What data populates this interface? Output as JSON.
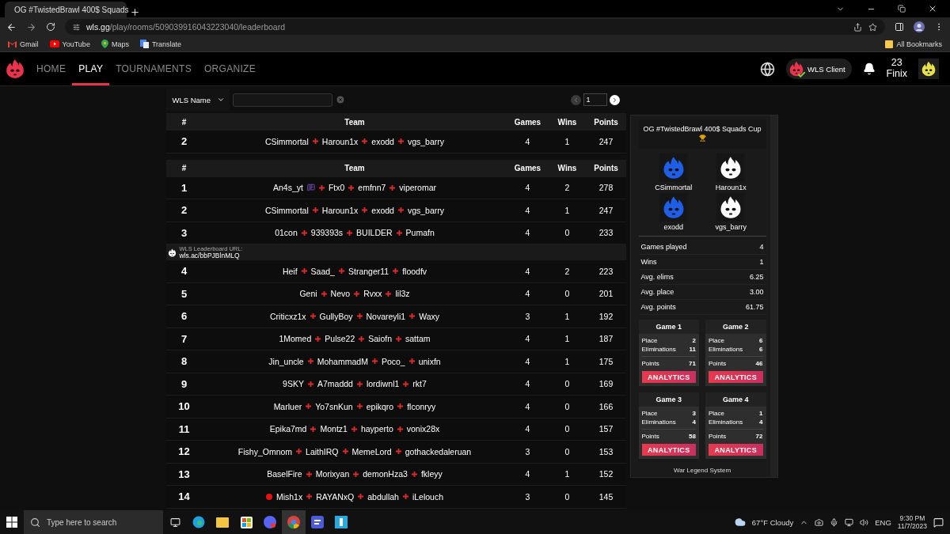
{
  "browser": {
    "tab_title": "OG #TwistedBrawl 400$ Squads",
    "url_host": "wls.gg",
    "url_path": "/play/rooms/509039916043223040/leaderboard",
    "bookmarks": [
      {
        "kind": "gmail",
        "label": "Gmail"
      },
      {
        "kind": "youtube",
        "label": "YouTube"
      },
      {
        "kind": "maps",
        "label": "Maps"
      },
      {
        "kind": "translate",
        "label": "Translate"
      }
    ],
    "all_bookmarks": "All Bookmarks"
  },
  "nav": {
    "items": [
      {
        "label": "HOME",
        "selected": false
      },
      {
        "label": "PLAY",
        "selected": true
      },
      {
        "label": "TOURNAMENTS",
        "selected": false
      },
      {
        "label": "ORGANIZE",
        "selected": false
      }
    ],
    "client_button": "WLS Client",
    "user_level": "23",
    "user_name": "Finix"
  },
  "filter": {
    "select": "WLS Name",
    "page_value": "1"
  },
  "highlight_table": {
    "columns": [
      "#",
      "Team",
      "Games",
      "Wins",
      "Points"
    ],
    "rows": [
      {
        "rank": "2",
        "members": [
          {
            "name": "CSimmortal"
          },
          {
            "name": "Haroun1x"
          },
          {
            "name": "exodd"
          },
          {
            "name": "vgs_barry"
          }
        ],
        "games": "4",
        "wins": "1",
        "points": "247"
      }
    ]
  },
  "leaderboard": {
    "columns": [
      "#",
      "Team",
      "Games",
      "Wins",
      "Points"
    ],
    "rows": [
      {
        "kind": "team",
        "rank": "1",
        "members": [
          {
            "kind": "streamer",
            "name": "An4s_yt"
          },
          {
            "kind": "plain",
            "name": "Ftx0"
          },
          {
            "kind": "plain",
            "name": "emfnn7"
          },
          {
            "kind": "plain",
            "name": "viperomar"
          }
        ],
        "games": "4",
        "wins": "2",
        "points": "278"
      },
      {
        "kind": "team",
        "rank": "2",
        "members": [
          {
            "kind": "plain",
            "name": "CSimmortal"
          },
          {
            "kind": "plain",
            "name": "Haroun1x"
          },
          {
            "kind": "plain",
            "name": "exodd"
          },
          {
            "kind": "plain",
            "name": "vgs_barry"
          }
        ],
        "games": "4",
        "wins": "1",
        "points": "247"
      },
      {
        "kind": "team",
        "rank": "3",
        "members": [
          {
            "kind": "plain",
            "name": "01con"
          },
          {
            "kind": "plain",
            "name": "939393s"
          },
          {
            "kind": "plain",
            "name": "BUILDER"
          },
          {
            "kind": "plain",
            "name": "Pumafn"
          }
        ],
        "games": "4",
        "wins": "0",
        "points": "233"
      },
      {
        "kind": "banner",
        "label": "WLS Leaderboard URL:",
        "url": "wls.ac/bbPJBlnMLQ"
      },
      {
        "kind": "team",
        "rank": "4",
        "members": [
          {
            "kind": "plain",
            "name": "Heif"
          },
          {
            "kind": "plain",
            "name": "Saad_"
          },
          {
            "kind": "plain",
            "name": "Stranger11"
          },
          {
            "kind": "plain",
            "name": "floodfv"
          }
        ],
        "games": "4",
        "wins": "2",
        "points": "223"
      },
      {
        "kind": "team",
        "rank": "5",
        "members": [
          {
            "kind": "plain",
            "name": "Geni"
          },
          {
            "kind": "plain",
            "name": "Nevo"
          },
          {
            "kind": "plain",
            "name": "Rvxx"
          },
          {
            "kind": "plain",
            "name": "lil3z"
          }
        ],
        "games": "4",
        "wins": "0",
        "points": "201"
      },
      {
        "kind": "team",
        "rank": "6",
        "members": [
          {
            "kind": "plain",
            "name": "Criticxz1x"
          },
          {
            "kind": "plain",
            "name": "GullyBoy"
          },
          {
            "kind": "plain",
            "name": "Novareyli1"
          },
          {
            "kind": "plain",
            "name": "Waxy"
          }
        ],
        "games": "3",
        "wins": "1",
        "points": "192"
      },
      {
        "kind": "team",
        "rank": "7",
        "members": [
          {
            "kind": "plain",
            "name": "1Momed"
          },
          {
            "kind": "plain",
            "name": "Pulse22"
          },
          {
            "kind": "plain",
            "name": "Saiofn"
          },
          {
            "kind": "plain",
            "name": "sattam"
          }
        ],
        "games": "4",
        "wins": "1",
        "points": "187"
      },
      {
        "kind": "team",
        "rank": "8",
        "members": [
          {
            "kind": "plain",
            "name": "Jin_uncle"
          },
          {
            "kind": "plain",
            "name": "MohammadM"
          },
          {
            "kind": "plain",
            "name": "Poco_"
          },
          {
            "kind": "plain",
            "name": "unixfn"
          }
        ],
        "games": "4",
        "wins": "1",
        "points": "175"
      },
      {
        "kind": "team",
        "rank": "9",
        "members": [
          {
            "kind": "plain",
            "name": "9SKY"
          },
          {
            "kind": "plain",
            "name": "A7maddd"
          },
          {
            "kind": "plain",
            "name": "lordiwnl1"
          },
          {
            "kind": "plain",
            "name": "rkt7"
          }
        ],
        "games": "4",
        "wins": "0",
        "points": "169"
      },
      {
        "kind": "team",
        "rank": "10",
        "members": [
          {
            "kind": "plain",
            "name": "Marluer"
          },
          {
            "kind": "plain",
            "name": "Yo7snKun"
          },
          {
            "kind": "plain",
            "name": "epikqro"
          },
          {
            "kind": "plain",
            "name": "flconryy"
          }
        ],
        "games": "4",
        "wins": "0",
        "points": "166"
      },
      {
        "kind": "team",
        "rank": "11",
        "members": [
          {
            "kind": "plain",
            "name": "Epika7md"
          },
          {
            "kind": "plain",
            "name": "Montz1"
          },
          {
            "kind": "plain",
            "name": "hayperto"
          },
          {
            "kind": "plain",
            "name": "vonix28x"
          }
        ],
        "games": "4",
        "wins": "0",
        "points": "157"
      },
      {
        "kind": "team",
        "rank": "12",
        "members": [
          {
            "kind": "plain",
            "name": "Fishy_Omnom"
          },
          {
            "kind": "plain",
            "name": "LaithIRQ"
          },
          {
            "kind": "plain",
            "name": "MemeLord"
          },
          {
            "kind": "plain",
            "name": "gothackedaleruan"
          }
        ],
        "games": "3",
        "wins": "0",
        "points": "153"
      },
      {
        "kind": "team",
        "rank": "13",
        "members": [
          {
            "kind": "plain",
            "name": "BaselFire"
          },
          {
            "kind": "plain",
            "name": "Morixyan"
          },
          {
            "kind": "plain",
            "name": "demonHza3"
          },
          {
            "kind": "plain",
            "name": "fkleyy"
          }
        ],
        "games": "4",
        "wins": "1",
        "points": "152"
      },
      {
        "kind": "team",
        "rank": "14",
        "members": [
          {
            "kind": "live",
            "name": "Mish1x"
          },
          {
            "kind": "plain",
            "name": "RAYANxQ"
          },
          {
            "kind": "plain",
            "name": "abdullah"
          },
          {
            "kind": "plain",
            "name": "iLelouch"
          }
        ],
        "games": "3",
        "wins": "0",
        "points": "145"
      }
    ]
  },
  "team_panel": {
    "title": "OG #TwistedBrawl 400$ Squads Cup",
    "players": [
      {
        "name": "CSimmortal",
        "color": "#1f5fe8"
      },
      {
        "name": "Haroun1x",
        "color": "#ffffff"
      },
      {
        "name": "exodd",
        "color": "#1f5fe8"
      },
      {
        "name": "vgs_barry",
        "color": "#ffffff"
      }
    ],
    "stats": [
      {
        "label": "Games played",
        "value": "4"
      },
      {
        "label": "Wins",
        "value": "1"
      },
      {
        "label": "Avg. elims",
        "value": "6.25"
      },
      {
        "label": "Avg. place",
        "value": "3.00"
      },
      {
        "label": "Avg. points",
        "value": "61.75"
      }
    ],
    "games": [
      {
        "title": "Game 1",
        "stats": [
          {
            "label": "Place",
            "value": "2"
          },
          {
            "label": "Eliminations",
            "value": "11"
          },
          {
            "label": "Points",
            "value": "71"
          }
        ],
        "button": "ANALYTICS"
      },
      {
        "title": "Game 2",
        "stats": [
          {
            "label": "Place",
            "value": "6"
          },
          {
            "label": "Eliminations",
            "value": "6"
          },
          {
            "label": "Points",
            "value": "46"
          }
        ],
        "button": "ANALYTICS"
      },
      {
        "title": "Game 3",
        "stats": [
          {
            "label": "Place",
            "value": "3"
          },
          {
            "label": "Eliminations",
            "value": "4"
          },
          {
            "label": "Points",
            "value": "58"
          }
        ],
        "button": "ANALYTICS"
      },
      {
        "title": "Game 4",
        "stats": [
          {
            "label": "Place",
            "value": "1"
          },
          {
            "label": "Eliminations",
            "value": "4"
          },
          {
            "label": "Points",
            "value": "72"
          }
        ],
        "button": "ANALYTICS"
      }
    ],
    "footer": "War Legend System"
  },
  "taskbar": {
    "search_placeholder": "Type here to search",
    "weather": "67°F  Cloudy",
    "language": "ENG",
    "time": "9:30 PM",
    "date": "11/7/2023"
  }
}
